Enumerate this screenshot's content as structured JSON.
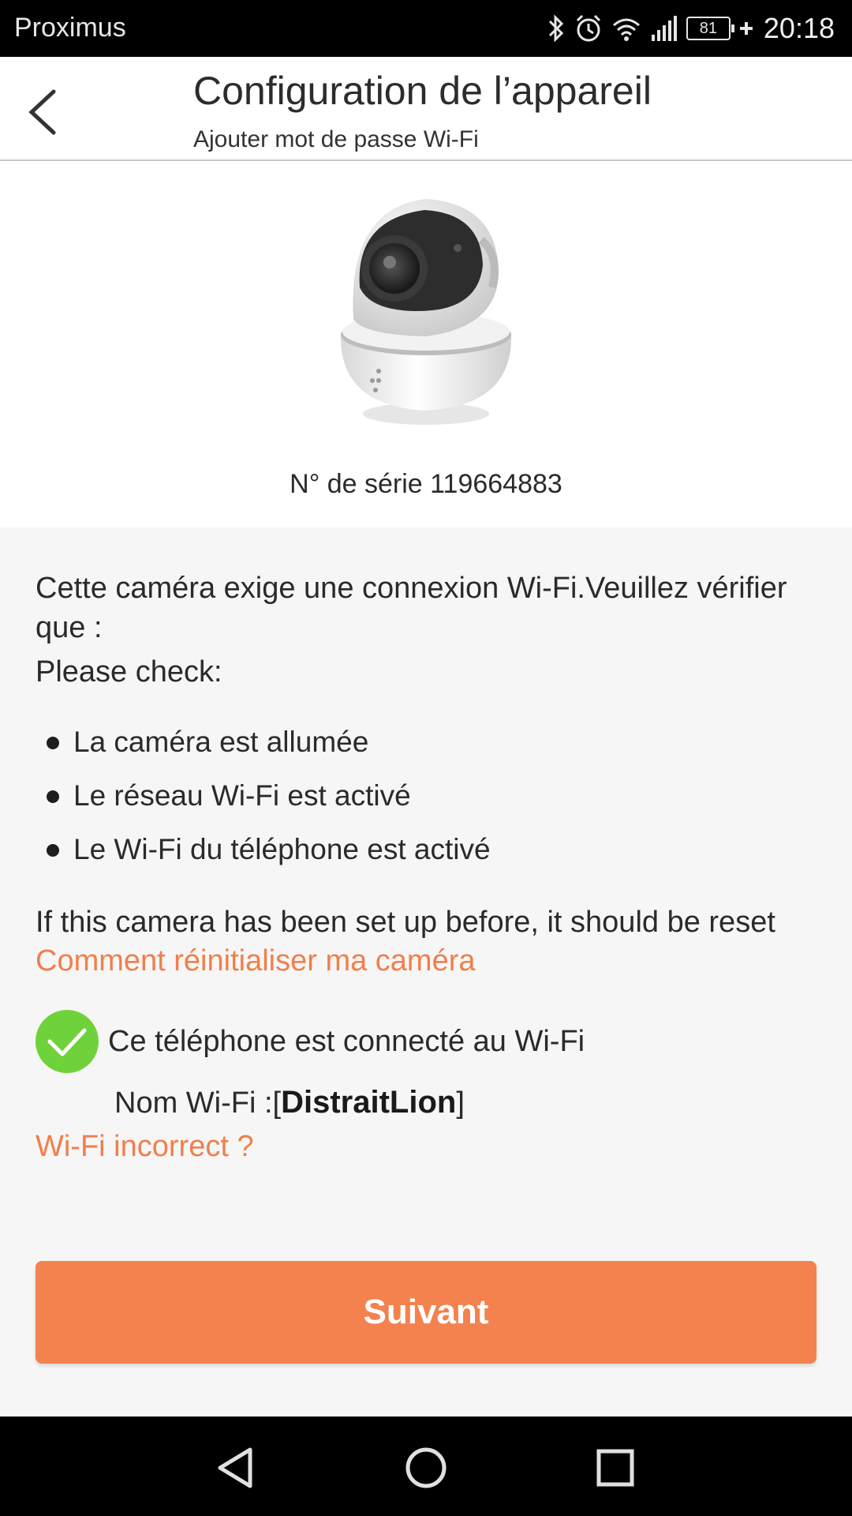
{
  "status_bar": {
    "carrier": "Proximus",
    "battery": "81",
    "time": "20:18",
    "icons": [
      "bluetooth-icon",
      "alarm-icon",
      "wifi-icon",
      "signal-icon",
      "battery-icon",
      "charging-icon"
    ]
  },
  "header": {
    "title": "Configuration de l’appareil",
    "subtitle": "Ajouter mot de passe Wi-Fi"
  },
  "device": {
    "serial": "N° de série 119664883"
  },
  "info": {
    "intro": "Cette caméra exige une connexion Wi-Fi.Veuillez vérifier que :",
    "check_label": "Please check:",
    "items": [
      "La caméra est allumée",
      "Le réseau Wi-Fi est activé",
      "Le Wi-Fi du téléphone est activé"
    ],
    "reset_note": "If this camera has been set up before, it should be reset",
    "reset_link": "Comment réinitialiser ma caméra"
  },
  "wifi": {
    "connected_text": "Ce téléphone est connecté au Wi-Fi",
    "name_label": "Nom Wi-Fi :[",
    "name": "DistraitLion",
    "name_close": "]",
    "incorrect_link": "Wi-Fi incorrect ?"
  },
  "actions": {
    "next_label": "Suivant"
  },
  "colors": {
    "accent": "#f3824e",
    "link": "#f07f4b",
    "check_green": "#6fd23a"
  }
}
